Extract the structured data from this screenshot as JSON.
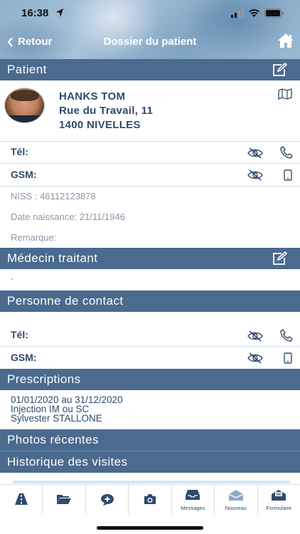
{
  "status_bar": {
    "time": "16:38"
  },
  "nav": {
    "back_label": "Retour",
    "title": "Dossier du patient"
  },
  "sections": {
    "patient": "Patient",
    "medecin": "Médecin traitant",
    "contact": "Personne de contact",
    "prescriptions": "Prescriptions",
    "photos": "Photos récentes",
    "historique": "Historique des visites"
  },
  "patient": {
    "name": "HANKS TOM",
    "address_line1": "Rue du Travail, 11",
    "address_line2": "1400 NIVELLES",
    "tel_label": "Tél:",
    "gsm_label": "GSM:",
    "niss": "NISS : 46112123878",
    "birth": "Date naissance: 21/11/1946",
    "remark": "Remarque:"
  },
  "medecin": {
    "value": "-"
  },
  "contact": {
    "tel_label": "Tél:",
    "gsm_label": "GSM:"
  },
  "prescription": {
    "dates": "01/01/2020 au 31/12/2020",
    "treatment": "Injection IM ou SC",
    "doctor": "Sylvester STALLONE"
  },
  "tabs": [
    {
      "icon": "road-icon",
      "label": ""
    },
    {
      "icon": "folder-open-icon",
      "label": ""
    },
    {
      "icon": "chat-add-icon",
      "label": ""
    },
    {
      "icon": "camera-icon",
      "label": ""
    },
    {
      "icon": "inbox-icon",
      "label": "Messages"
    },
    {
      "icon": "envelope-open-icon",
      "label": "Nouveau"
    },
    {
      "icon": "form-envelope-icon",
      "label": "Formulaire"
    }
  ],
  "colors": {
    "section_bar": "#4a6a8e",
    "text": "#2f4a6d",
    "muted_text": "#8b98a9"
  }
}
